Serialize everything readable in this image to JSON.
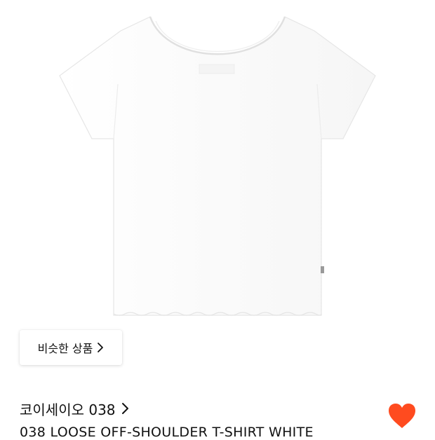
{
  "similar_button": {
    "label": "비슷한 상품"
  },
  "brand": {
    "name": "코이세이오 038"
  },
  "product": {
    "title": "038 LOOSE OFF-SHOULDER T-SHIRT WHITE"
  },
  "wishlist": {
    "liked": true,
    "color": "#FF4B1F"
  },
  "icons": {
    "similar_chevron": "chevron-right-icon",
    "brand_chevron": "chevron-right-icon",
    "wishlist": "heart-icon"
  }
}
